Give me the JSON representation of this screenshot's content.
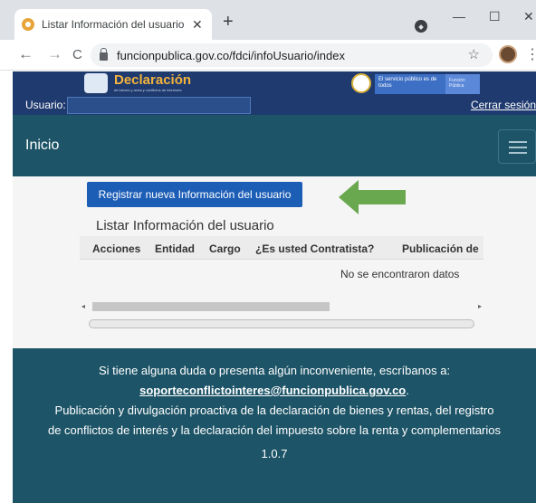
{
  "browser": {
    "tab_title": "Listar Información del usuario - S",
    "tab_close": "✕",
    "new_tab": "+",
    "url": "funcionpublica.gov.co/fdci/infoUsuario/index",
    "back": "←",
    "forward": "→",
    "reload": "C",
    "star": "☆",
    "minimize": "—",
    "maximize": "☐",
    "close": "✕",
    "kebab": "⋮"
  },
  "header": {
    "logo_title": "Declaración",
    "logo_subtitle": "de bienes y renta y conflictos de intereses",
    "gov_badge": "El servicio público es de todos",
    "fp_badge": "Función Pública",
    "user_label": "Usuario:",
    "user_value": "",
    "logout": "Cerrar sesión"
  },
  "nav": {
    "brand": "Inicio"
  },
  "main": {
    "register_button": "Registrar nueva Información del usuario",
    "list_title": "Listar Información del usuario",
    "columns": [
      "Acciones",
      "Entidad",
      "Cargo",
      "¿Es usted Contratista?",
      "Publicación de"
    ],
    "empty_message": "No se encontraron datos",
    "scroll_left": "◂",
    "scroll_right": "▸"
  },
  "footer": {
    "line1": "Si tiene alguna duda o presenta algún inconveniente, escríbanos a:",
    "email": "soporteconflictointeres@funcionpublica.gov.co",
    "email_suffix": ".",
    "line2": "Publicación y divulgación proactiva de la declaración de bienes y rentas, del registro de conflictos de interés y la declaración del impuesto sobre la renta y complementarios",
    "version": "1.0.7"
  },
  "colors": {
    "header_bg": "#1f3a6e",
    "nav_bg": "#1d5467",
    "button_bg": "#1c5db6",
    "arrow": "#6aa84f",
    "logo_accent": "#f3b33d"
  }
}
